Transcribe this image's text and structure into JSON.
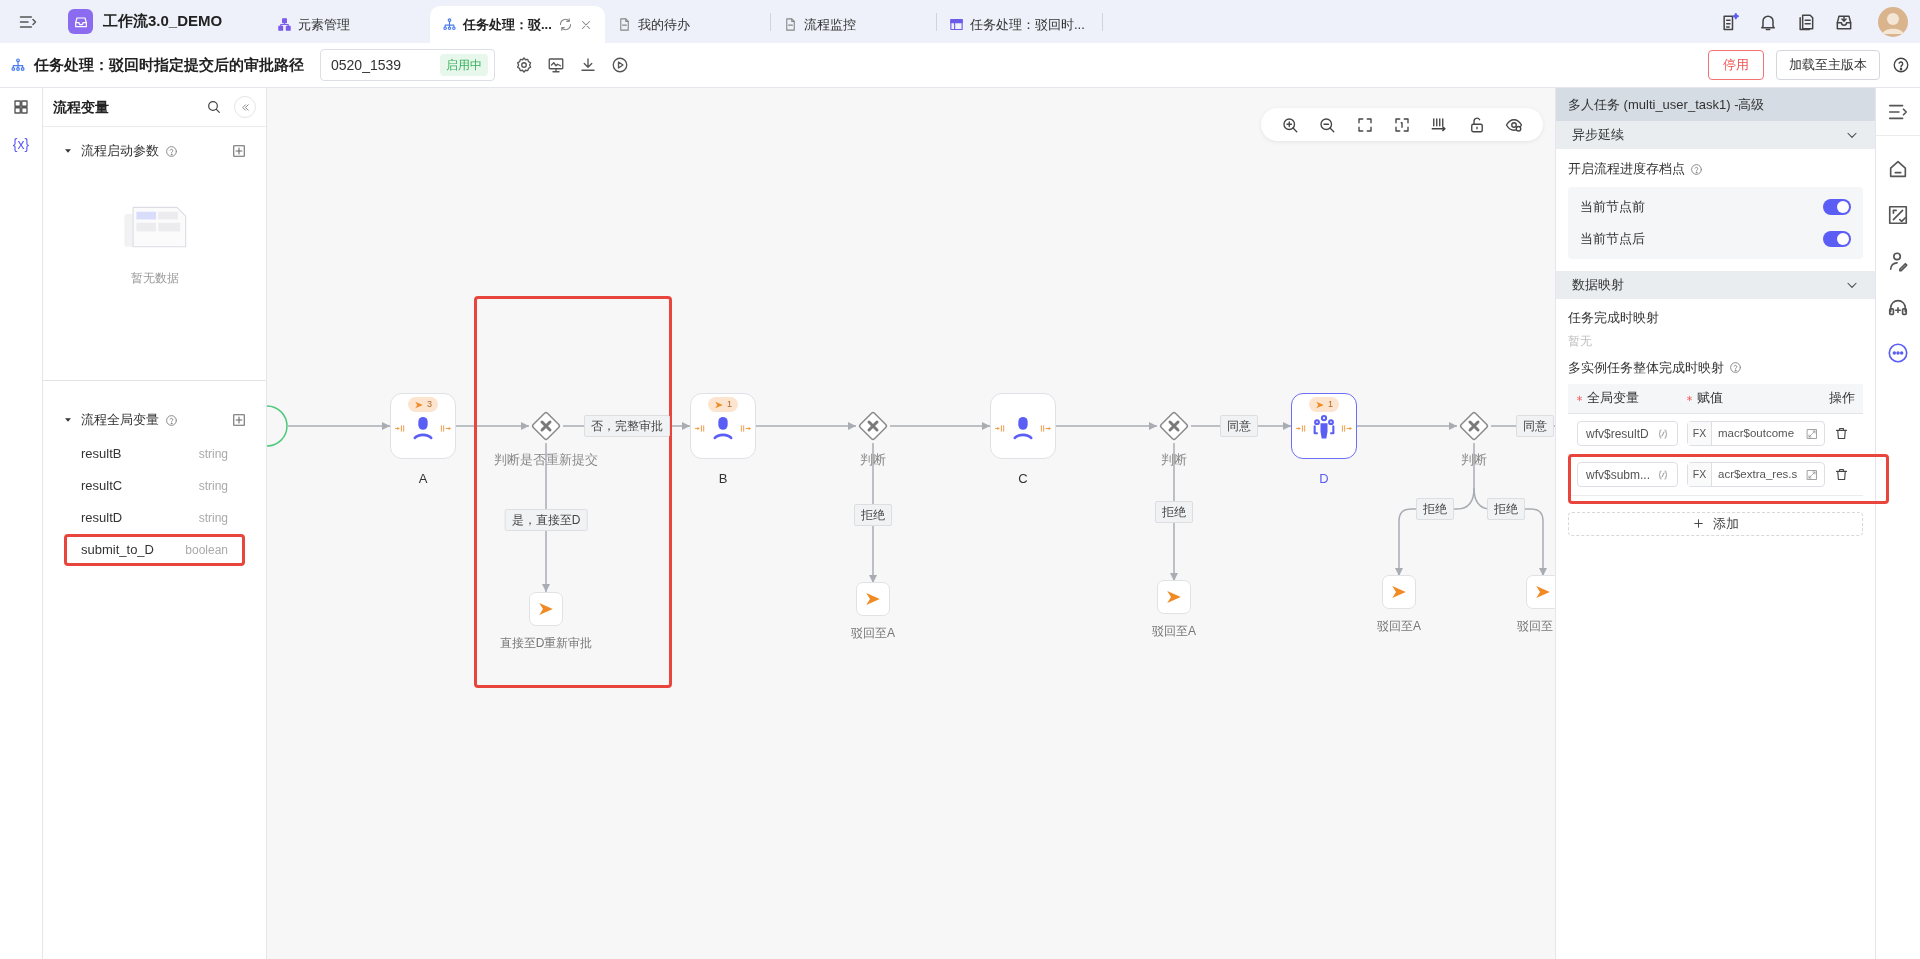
{
  "app": {
    "title": "工作流3.0_DEMO"
  },
  "tabs": [
    {
      "label": "元素管理",
      "selected": false
    },
    {
      "label": "任务处理：驳...",
      "selected": true
    },
    {
      "label": "我的待办",
      "selected": false
    },
    {
      "label": "流程监控",
      "selected": false
    },
    {
      "label": "任务处理：驳回时...",
      "selected": false
    }
  ],
  "process": {
    "title": "任务处理：驳回时指定提交后的审批路径",
    "version": "0520_1539",
    "status": "启用中"
  },
  "actions": [
    {
      "label": "停用",
      "kind": "danger"
    },
    {
      "label": "加载至主版本",
      "kind": "default"
    }
  ],
  "left_rail": [
    {
      "kind": "grid",
      "selected": false
    },
    {
      "kind": "variables",
      "label": "{x}",
      "selected": true
    }
  ],
  "variables_panel": {
    "title": "流程变量",
    "sections": [
      {
        "title": "流程启动参数",
        "expanded": true,
        "empty_text": "暂无数据"
      },
      {
        "title": "流程全局变量",
        "expanded": true,
        "items": [
          {
            "name": "resultB",
            "type": "string",
            "highlighted": false
          },
          {
            "name": "resultC",
            "type": "string",
            "highlighted": false
          },
          {
            "name": "resultD",
            "type": "string",
            "highlighted": false
          },
          {
            "name": "submit_to_D",
            "type": "boolean",
            "highlighted": true
          }
        ]
      }
    ]
  },
  "canvas": {
    "nodes": [
      {
        "kind": "start",
        "highlighted": false
      },
      {
        "kind": "user_task",
        "label": "A",
        "badge": "3",
        "selected": false,
        "highlighted": false
      },
      {
        "kind": "gateway",
        "label": "判断是否重新提交",
        "highlighted": true
      },
      {
        "kind": "send_end",
        "label": "直接至D重新审批",
        "highlighted": false
      },
      {
        "kind": "user_task",
        "label": "B",
        "badge": "1",
        "selected": false,
        "highlighted": false
      },
      {
        "kind": "gateway",
        "label": "判断",
        "highlighted": false
      },
      {
        "kind": "send_end",
        "label": "驳回至A",
        "highlighted": false
      },
      {
        "kind": "user_task",
        "label": "C",
        "selected": false,
        "highlighted": false
      },
      {
        "kind": "gateway",
        "label": "判断",
        "highlighted": false
      },
      {
        "kind": "send_end",
        "label": "驳回至A",
        "highlighted": false
      },
      {
        "kind": "multi_task",
        "label": "D",
        "badge": "1",
        "selected": true,
        "highlighted": false
      },
      {
        "kind": "gateway",
        "label": "判断",
        "highlighted": false
      },
      {
        "kind": "send_end",
        "label": "驳回至A",
        "highlighted": false
      },
      {
        "kind": "send_end",
        "label": "驳回至",
        "highlighted": false
      }
    ],
    "edge_labels": [
      "否，完整审批",
      "是，直接至D",
      "拒绝",
      "同意",
      "拒绝",
      "拒绝",
      "拒绝",
      "同意"
    ]
  },
  "properties": {
    "title": "多人任务 (multi_user_task1) -高级",
    "async": {
      "title": "异步延续",
      "expanded": true,
      "label": "开启流程进度存档点",
      "toggles": [
        {
          "label": "当前节点前",
          "on": true
        },
        {
          "label": "当前节点后",
          "on": true
        }
      ]
    },
    "mapping": {
      "title": "数据映射",
      "expanded": true,
      "task_label": "任务完成时映射",
      "task_empty": "暂无",
      "multi_label": "多实例任务整体完成时映射",
      "columns": [
        {
          "label": "全局变量",
          "required": true
        },
        {
          "label": "赋值",
          "required": true
        },
        {
          "label": "操作",
          "required": false
        }
      ],
      "rows": [
        {
          "variable": "wfv$resultD",
          "fx": "FX",
          "value": "macr$outcome",
          "highlighted": false
        },
        {
          "variable": "wfv$subm...",
          "fx": "FX",
          "value": "acr$extra_res.s",
          "highlighted": true
        }
      ],
      "add_label": "添加"
    }
  },
  "right_rail": [
    {
      "kind": "collapse",
      "selected": false
    },
    {
      "kind": "home",
      "selected": false
    },
    {
      "kind": "percent",
      "selected": false
    },
    {
      "kind": "user",
      "selected": false
    },
    {
      "kind": "headset",
      "selected": false
    },
    {
      "kind": "more",
      "selected": true
    }
  ]
}
